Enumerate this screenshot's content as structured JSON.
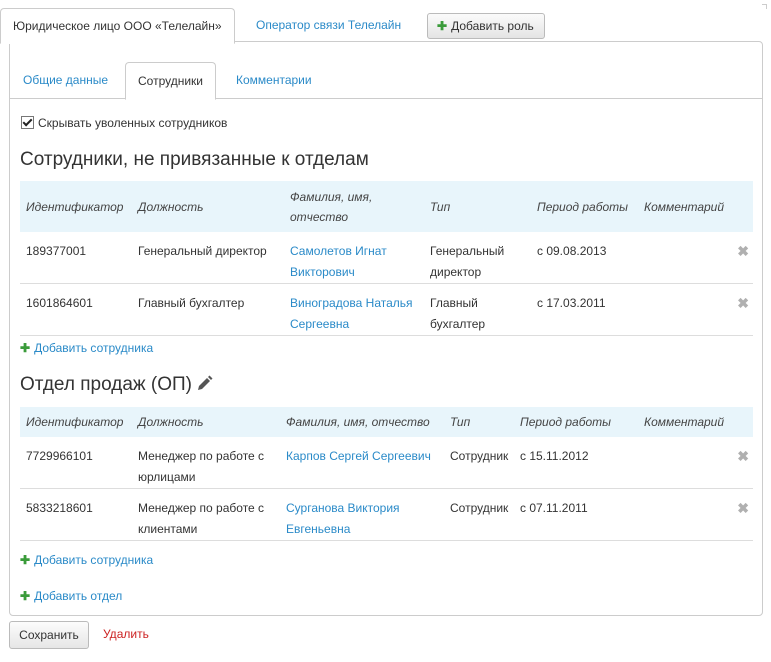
{
  "top_tabs": {
    "active": "Юридическое лицо ООО «Телелайн»",
    "second": "Оператор связи Телелайн",
    "add_role": "Добавить роль"
  },
  "sub_tabs": [
    "Общие данные",
    "Сотрудники",
    "Комментарии"
  ],
  "hide_fired_label": "Скрывать уволенных сотрудников",
  "hide_fired_checked": true,
  "section1": {
    "title": "Сотрудники, не привязанные к отделам",
    "columns": [
      "Идентификатор",
      "Должность",
      "Фамилия, имя, отчество",
      "Тип",
      "Период работы",
      "Комментарий"
    ],
    "rows": [
      {
        "id": "189377001",
        "position": "Генеральный директор",
        "name": "Самолетов Игнат Викторович",
        "type": "Генеральный директор",
        "period": "с 09.08.2013",
        "comment": ""
      },
      {
        "id": "1601864601",
        "position": "Главный бухгалтер",
        "name": "Виноградова Наталья Сергеевна",
        "type": "Главный бухгалтер",
        "period": "с 17.03.2011",
        "comment": ""
      }
    ],
    "add_employee": "Добавить сотрудника"
  },
  "section2": {
    "title": "Отдел продаж (ОП)",
    "columns": [
      "Идентификатор",
      "Должность",
      "Фамилия, имя, отчество",
      "Тип",
      "Период работы",
      "Комментарий"
    ],
    "rows": [
      {
        "id": "7729966101",
        "position": "Менеджер по работе с юрлицами",
        "name": "Карпов Сергей Сергеевич",
        "type": "Сотрудник",
        "period": "с 15.11.2012",
        "comment": ""
      },
      {
        "id": "5833218601",
        "position": "Менеджер по работе с клиентами",
        "name": "Сурганова Виктория Евгеньевна",
        "type": "Сотрудник",
        "period": "с 07.11.2011",
        "comment": ""
      }
    ],
    "add_employee": "Добавить сотрудника"
  },
  "add_department": "Добавить отдел",
  "buttons": {
    "save": "Сохранить",
    "delete": "Удалить"
  },
  "icons": {
    "plus": "plus-icon",
    "delete": "close-icon",
    "edit": "pencil-icon"
  },
  "colors": {
    "link": "#2a8ac8",
    "plus": "#3a9b3a",
    "delete": "#cc2222",
    "table_header": "#e8f5fb"
  }
}
